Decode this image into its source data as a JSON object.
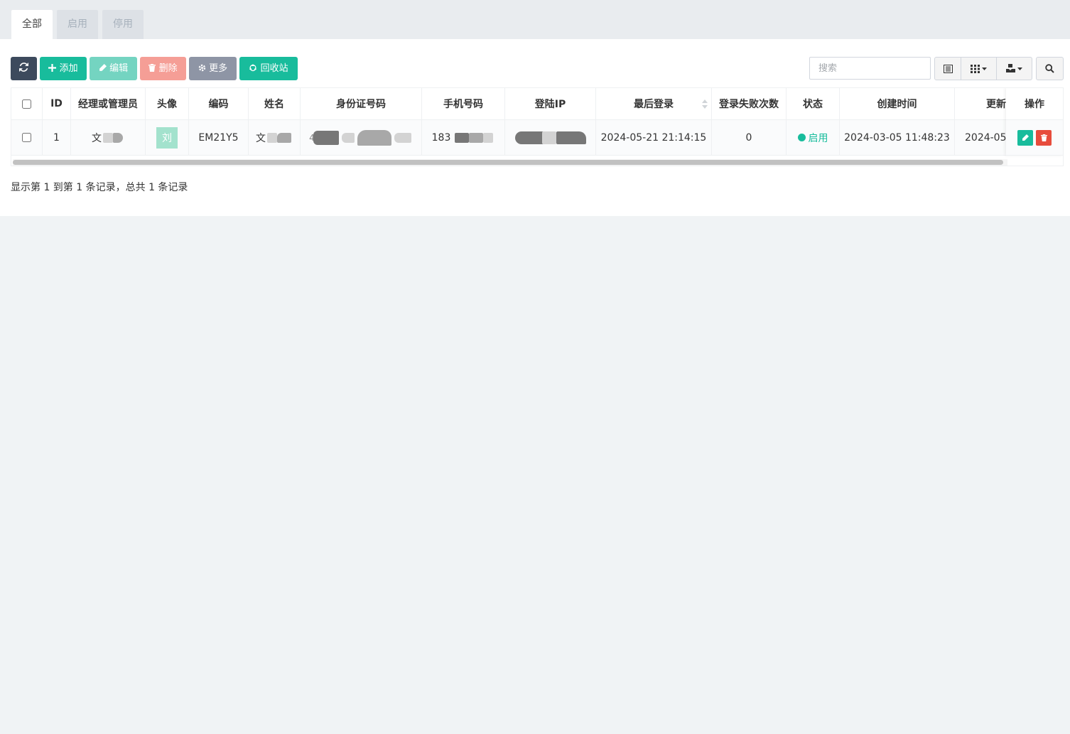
{
  "tabs": [
    {
      "label": "全部",
      "active": true
    },
    {
      "label": "启用",
      "active": false
    },
    {
      "label": "停用",
      "active": false
    }
  ],
  "toolbar": {
    "refresh_icon": "refresh-icon",
    "add_label": "添加",
    "edit_label": "编辑",
    "delete_label": "删除",
    "more_label": "更多",
    "recycle_label": "回收站",
    "search_placeholder": "搜索"
  },
  "colors": {
    "dark": "#3d4a5d",
    "success": "#18bc9c",
    "success_light": "#74d4c1",
    "danger_light": "#f59e96",
    "gray": "#8e95a5",
    "danger": "#e74c3c"
  },
  "table": {
    "headers": {
      "id": "ID",
      "manager": "经理或管理员",
      "avatar": "头像",
      "code": "编码",
      "name": "姓名",
      "idcard": "身份证号码",
      "phone": "手机号码",
      "login_ip": "登陆IP",
      "last_login": "最后登录",
      "fail_count": "登录失败次数",
      "status": "状态",
      "created": "创建时间",
      "updated": "更新",
      "actions": "操作"
    },
    "rows": [
      {
        "id": "1",
        "manager": "文",
        "avatar_char": "刘",
        "code": "EM21Y5",
        "name": "文",
        "idcard": "4",
        "phone": "183",
        "login_ip": "",
        "last_login": "2024-05-21 21:14:15",
        "fail_count": "0",
        "status": "启用",
        "created": "2024-03-05 11:48:23",
        "updated": "2024-05-"
      }
    ]
  },
  "footer": {
    "summary": "显示第 1 到第 1 条记录，总共 1 条记录"
  }
}
